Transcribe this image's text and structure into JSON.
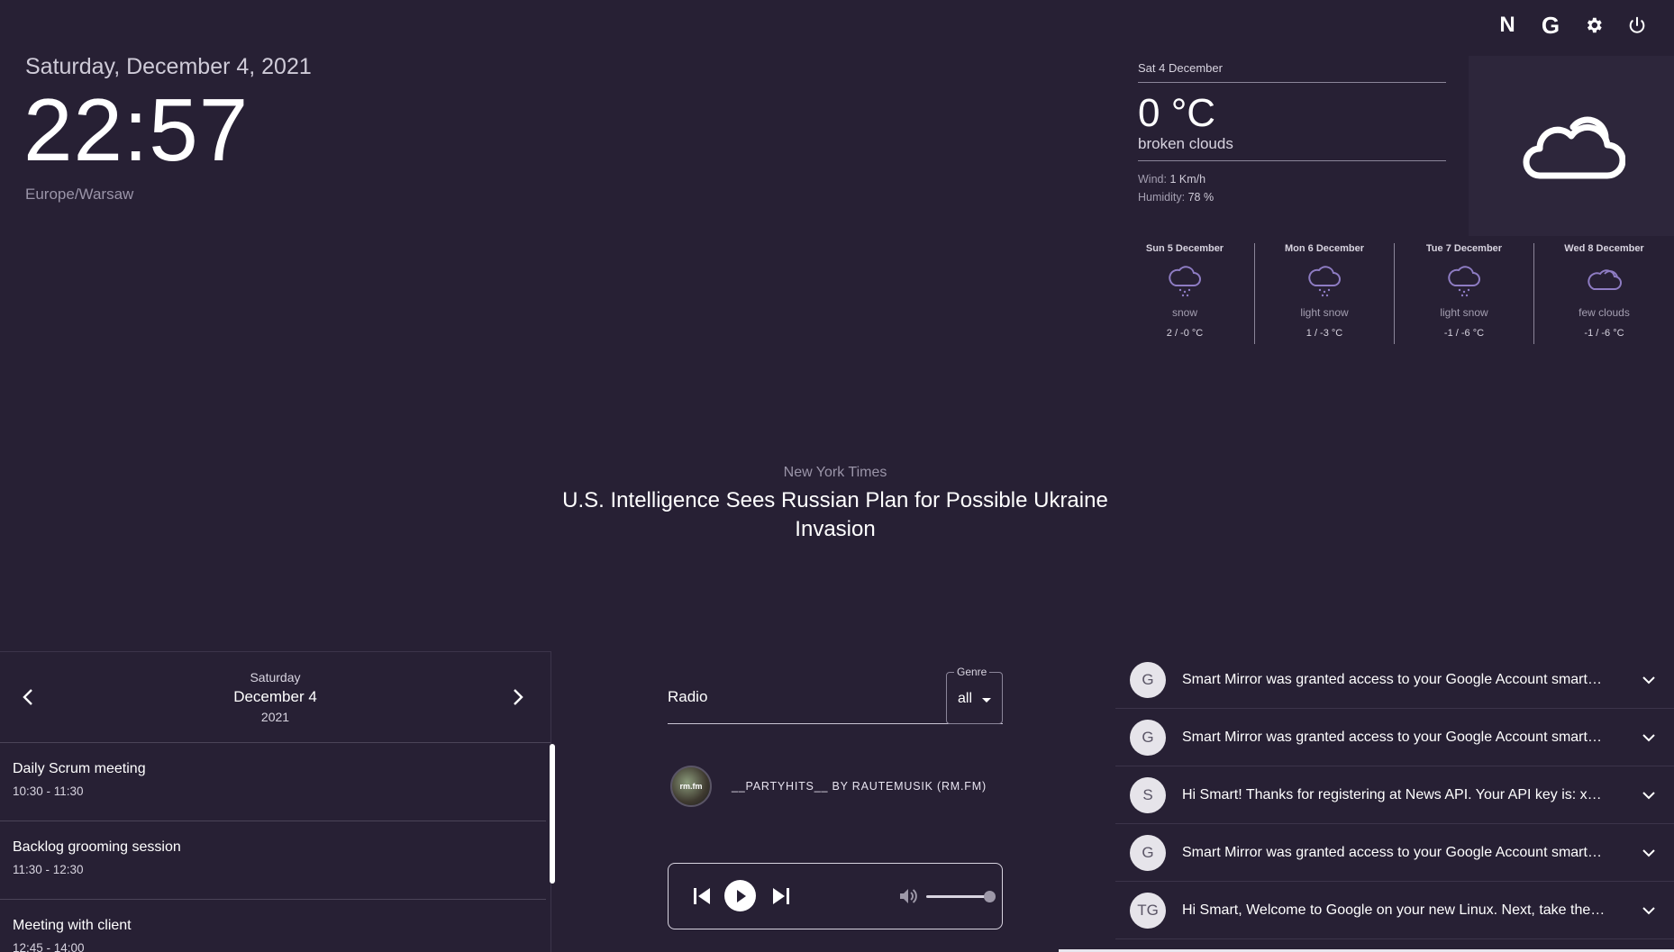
{
  "header": {
    "icons": [
      {
        "name": "netflix-icon",
        "glyph": "N"
      },
      {
        "name": "google-icon",
        "glyph": "G"
      },
      {
        "name": "gear-icon"
      },
      {
        "name": "power-icon"
      }
    ]
  },
  "clock": {
    "date": "Saturday, December 4, 2021",
    "time": "22:57",
    "timezone": "Europe/Warsaw"
  },
  "weather": {
    "date": "Sat 4 December",
    "temperature": "0 °C",
    "description": "broken clouds",
    "wind_label": "Wind:",
    "wind_value": "1 Km/h",
    "humidity_label": "Humidity:",
    "humidity_value": "78 %",
    "icon": "broken-clouds-icon",
    "forecast": [
      {
        "day": "Sun 5 December",
        "desc": "snow",
        "temp": "2 / -0 °C",
        "icon": "snow-icon"
      },
      {
        "day": "Mon 6 December",
        "desc": "light snow",
        "temp": "1 / -3 °C",
        "icon": "snow-icon"
      },
      {
        "day": "Tue 7 December",
        "desc": "light snow",
        "temp": "-1 / -6 °C",
        "icon": "snow-icon"
      },
      {
        "day": "Wed 8 December",
        "desc": "few clouds",
        "temp": "-1 / -6 °C",
        "icon": "cloud-icon"
      }
    ]
  },
  "news": {
    "source": "New York Times",
    "title": "U.S. Intelligence Sees Russian Plan for Possible Ukraine Invasion"
  },
  "calendar": {
    "weekday": "Saturday",
    "month_day": "December 4",
    "year": "2021",
    "events": [
      {
        "title": "Daily Scrum meeting",
        "time": "10:30 - 11:30"
      },
      {
        "title": "Backlog grooming session",
        "time": "11:30 - 12:30"
      },
      {
        "title": "Meeting with client",
        "time": "12:45 - 14:00"
      }
    ]
  },
  "radio": {
    "label": "Radio",
    "genre_label": "Genre",
    "genre_value": "all",
    "station_logo_text": "rm.fm",
    "station_name": "__PARTYHITS__ BY RAUTEMUSIK (RM.FM)",
    "volume": 1.0
  },
  "mail": {
    "items": [
      {
        "avatar": "G",
        "subject": "Smart Mirror was granted access to your Google Account smartmirror@example.com"
      },
      {
        "avatar": "G",
        "subject": "Smart Mirror was granted access to your Google Account smartmirror@example.com"
      },
      {
        "avatar": "S",
        "subject": "Hi Smart! Thanks for registering at News API. Your API key is: xxxxxxxx"
      },
      {
        "avatar": "G",
        "subject": "Smart Mirror was granted access to your Google Account smartmirror@example.com"
      },
      {
        "avatar": "TG",
        "subject": "Hi Smart, Welcome to Google on your new Linux. Next, take the steps"
      }
    ]
  },
  "colors": {
    "background": "#272034",
    "panel": "#2d263b",
    "accent_icon": "#8e7cc3",
    "text": "#ffffff",
    "muted": "#9a94a8"
  }
}
